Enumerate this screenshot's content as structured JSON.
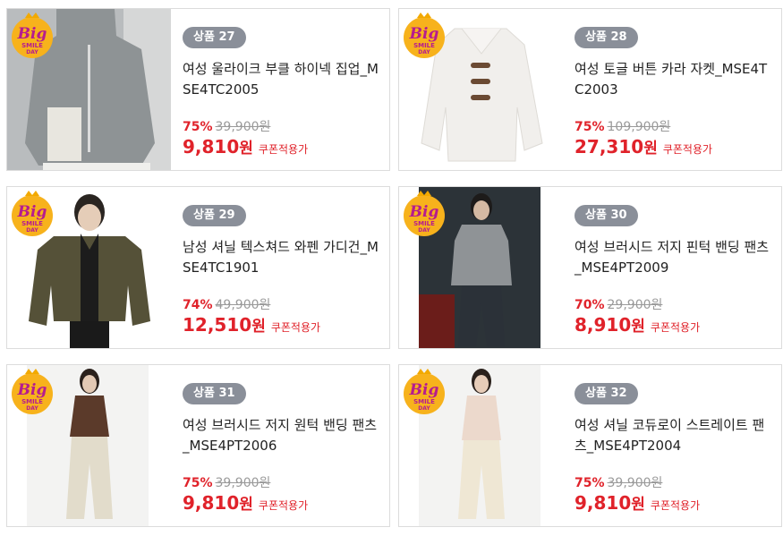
{
  "badge": {
    "big": "Big",
    "line1": "SMILE",
    "line2": "DAY"
  },
  "colors": {
    "accent": "#e0222a",
    "pill": "#8a8f99",
    "badge_bg": "#f7b21c",
    "badge_text": "#b61c8f"
  },
  "products": [
    {
      "tag": "상품 27",
      "title": "여성 울라이크 부클 하이넥 집업_MSE4TC2005",
      "discount": "75%",
      "original": "39,900원",
      "sale": "9,810",
      "won": "원",
      "coupon": "쿠폰적용가"
    },
    {
      "tag": "상품 28",
      "title": "여성 토글 버튼 카라 자켓_MSE4TC2003",
      "discount": "75%",
      "original": "109,900원",
      "sale": "27,310",
      "won": "원",
      "coupon": "쿠폰적용가"
    },
    {
      "tag": "상품 29",
      "title": "남성 셔닐 텍스쳐드 와펜 가디건_MSE4TC1901",
      "discount": "74%",
      "original": "49,900원",
      "sale": "12,510",
      "won": "원",
      "coupon": "쿠폰적용가"
    },
    {
      "tag": "상품 30",
      "title": "여성 브러시드 저지 핀턱 밴딩 팬츠_MSE4PT2009",
      "discount": "70%",
      "original": "29,900원",
      "sale": "8,910",
      "won": "원",
      "coupon": "쿠폰적용가"
    },
    {
      "tag": "상품 31",
      "title": "여성 브러시드 저지 원턱 밴딩 팬츠_MSE4PT2006",
      "discount": "75%",
      "original": "39,900원",
      "sale": "9,810",
      "won": "원",
      "coupon": "쿠폰적용가"
    },
    {
      "tag": "상품 32",
      "title": "여성 셔닐 코듀로이 스트레이트 팬츠_MSE4PT2004",
      "discount": "75%",
      "original": "39,900원",
      "sale": "9,810",
      "won": "원",
      "coupon": "쿠폰적용가"
    }
  ]
}
